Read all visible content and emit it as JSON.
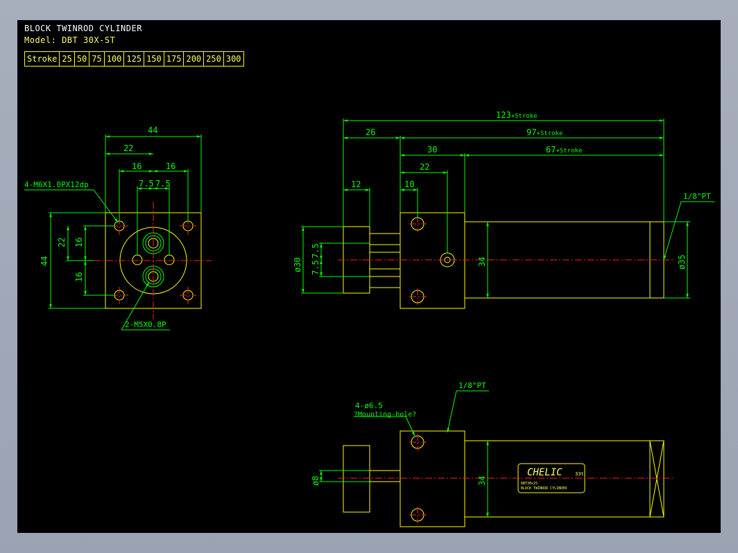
{
  "title": "BLOCK TWINROD CYLINDER",
  "model": "Model: DBT 30X-ST",
  "stroke_table": {
    "label": "Stroke",
    "values": [
      "25",
      "50",
      "75",
      "100",
      "125",
      "150",
      "175",
      "200",
      "250",
      "300"
    ]
  },
  "dims": {
    "front": {
      "w44": "44",
      "w22": "22",
      "w16a": "16",
      "w16b": "16",
      "w75a": "7.5",
      "w75b": "7.5",
      "h44": "44",
      "h22": "22",
      "h16a": "16",
      "h16b": "16",
      "thread_top": "4-M6X1.0PX12dp",
      "thread_bottom": "2-M5X0.8P"
    },
    "side": {
      "total": "123",
      "total_suffix": "+Stroke",
      "d26": "26",
      "d97": "97",
      "d97_suffix": "+Stroke",
      "d30": "30",
      "d67": "67",
      "d67_suffix": "+Stroke",
      "d22": "22",
      "d12": "12",
      "d10": "10",
      "port": "1/8\"PT",
      "dia30": "ø30",
      "d75a": "7.5",
      "d75b": "7.5",
      "d34": "34",
      "dia35": "ø35"
    },
    "bottom": {
      "port": "1/8\"PT",
      "holes": "4-ø6.5",
      "holes_note": "?Mounting-hole?",
      "dia8": "ø8",
      "d34": "34"
    }
  },
  "label_plate": {
    "brand": "CHELIC",
    "code": "33t",
    "line1": "DBT30x25",
    "line2": "BLOCK TWINROD CYLINDER"
  },
  "colors": {
    "background": "#000000",
    "line": "#ffff00",
    "dimension": "#00ff00",
    "center": "#ff2020",
    "text": "#ffffff"
  }
}
